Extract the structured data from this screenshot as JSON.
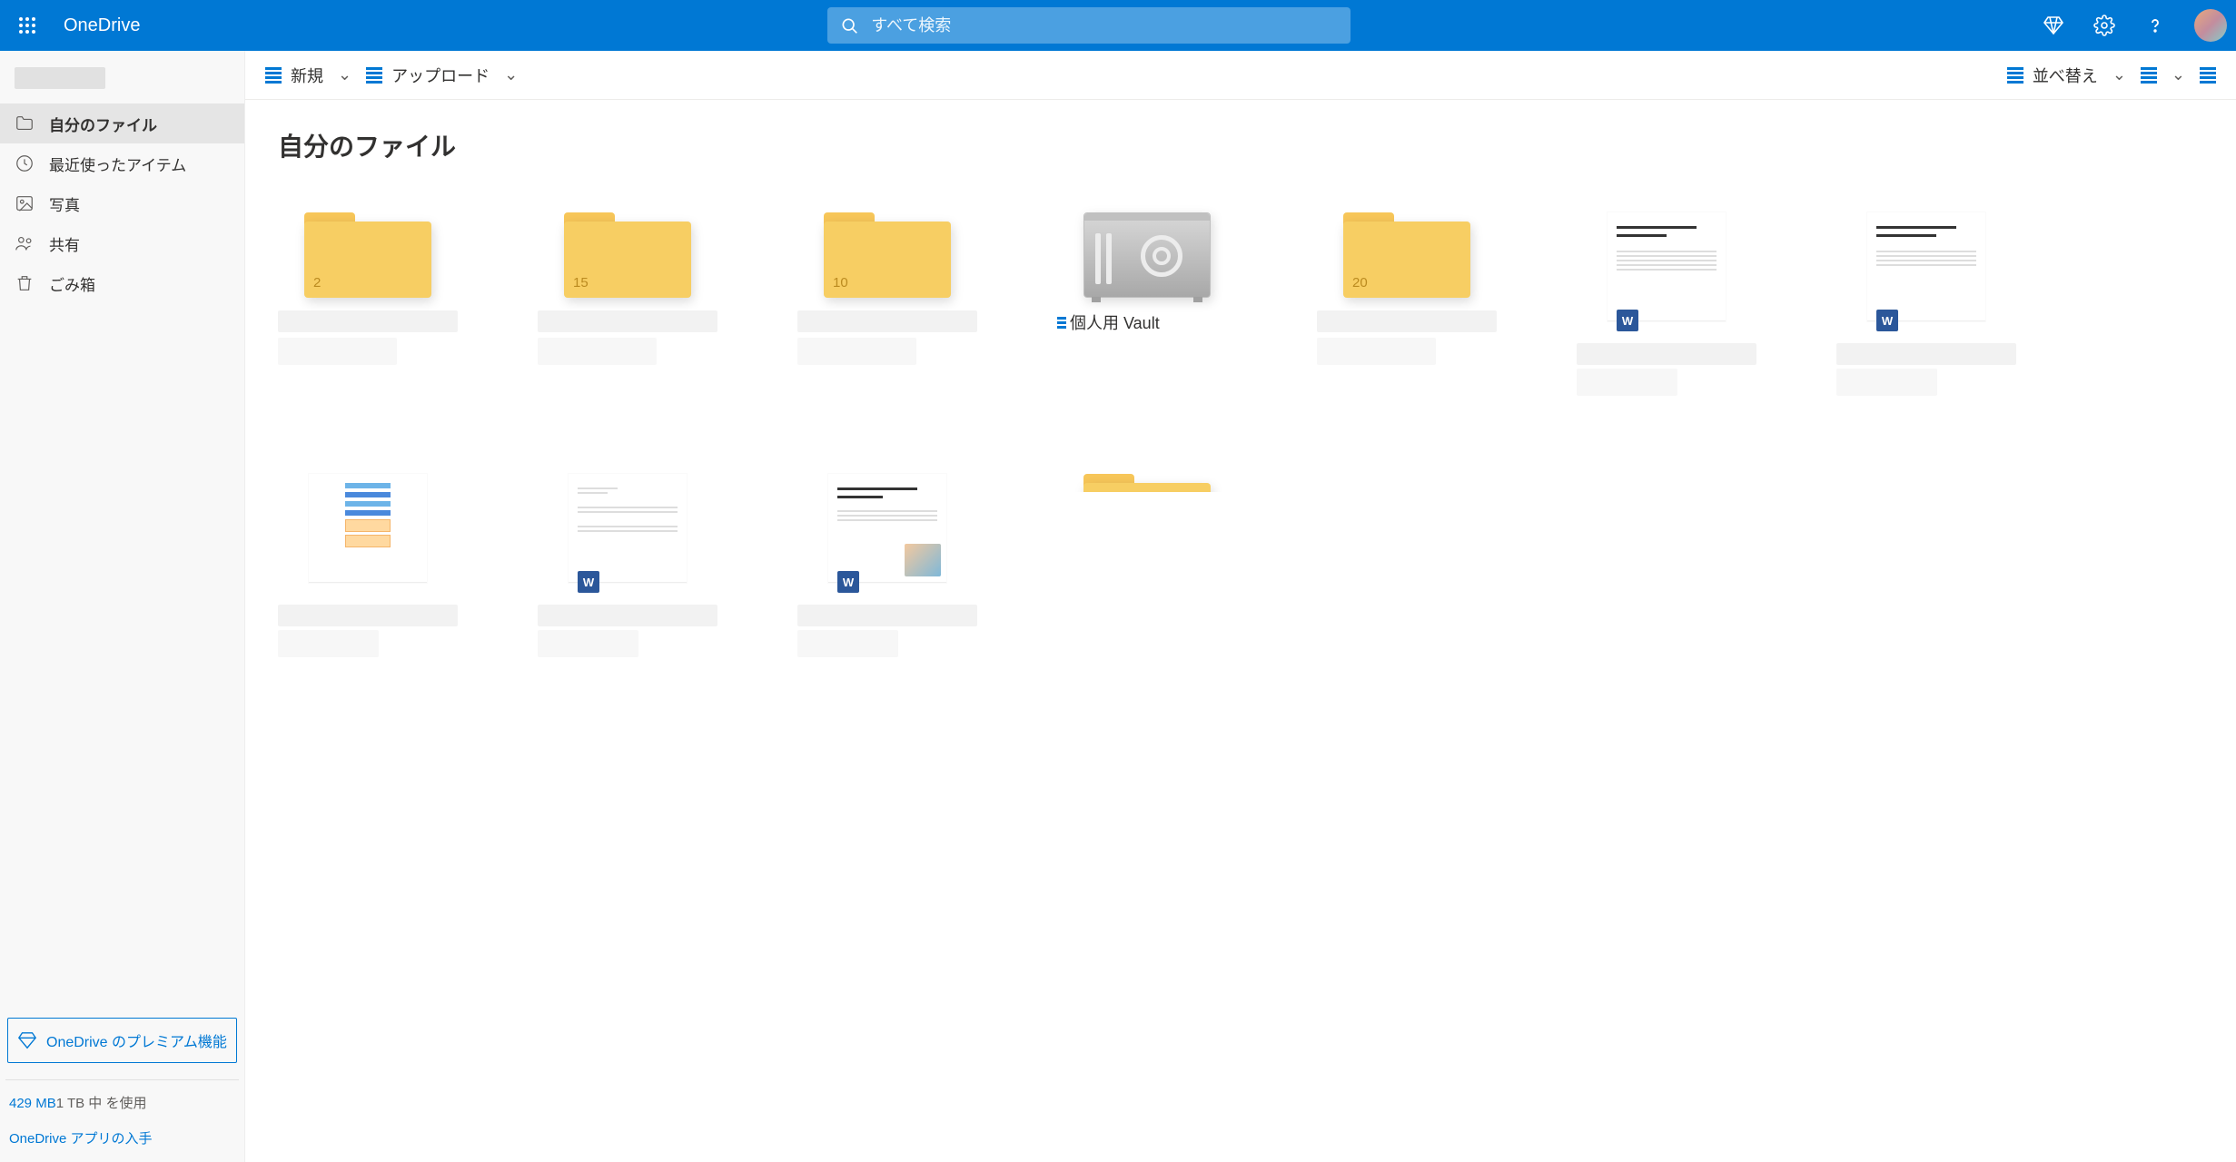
{
  "header": {
    "brand": "OneDrive",
    "search_placeholder": "すべて検索"
  },
  "sidebar": {
    "items": [
      {
        "key": "my-files",
        "label": "自分のファイル",
        "active": true
      },
      {
        "key": "recent",
        "label": "最近使ったアイテム",
        "active": false
      },
      {
        "key": "photos",
        "label": "写真",
        "active": false
      },
      {
        "key": "shared",
        "label": "共有",
        "active": false
      },
      {
        "key": "recycle",
        "label": "ごみ箱",
        "active": false
      }
    ],
    "premium_label": "OneDrive のプレミアム機能",
    "storage_used": "429 MB",
    "storage_total": "1 TB 中 を使用",
    "get_app": "OneDrive アプリの入手"
  },
  "commands": {
    "new_label": "新規",
    "upload_label": "アップロード",
    "sort_label": "並べ替え"
  },
  "page": {
    "title": "自分のファイル"
  },
  "folders": [
    {
      "count": "2"
    },
    {
      "count": "15"
    },
    {
      "count": "10"
    },
    {
      "type": "vault",
      "label": "個人用 Vault"
    },
    {
      "count": "20"
    }
  ],
  "files": [
    {
      "type": "word",
      "style": "text"
    },
    {
      "type": "word",
      "style": "text"
    },
    {
      "type": "none",
      "style": "blueblocks"
    },
    {
      "type": "word",
      "style": "sparse"
    },
    {
      "type": "word",
      "style": "text_image"
    }
  ]
}
